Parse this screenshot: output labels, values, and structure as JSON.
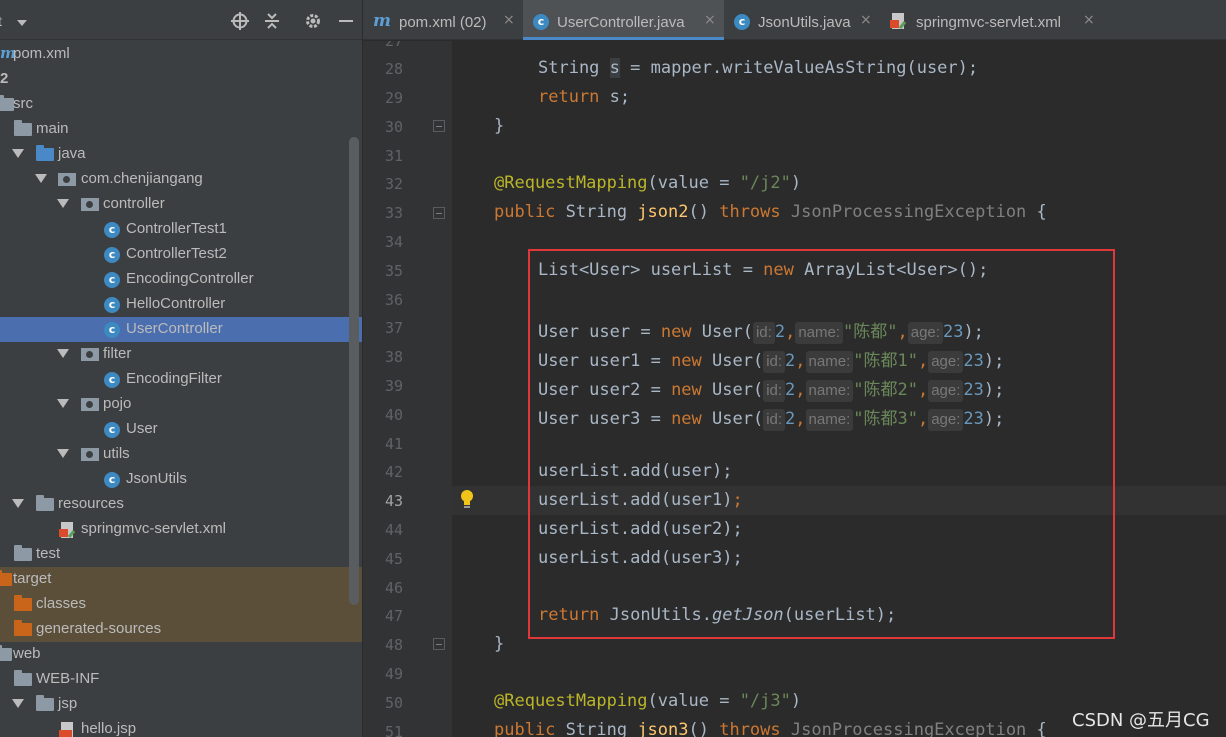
{
  "panel": {
    "title": "t",
    "tree": [
      {
        "label": "pom.xml",
        "icon": "maven-icon"
      },
      {
        "label": "2",
        "icon": "none"
      },
      {
        "label": "src",
        "icon": "folder-icon"
      },
      {
        "label": "main",
        "icon": "folder-icon"
      },
      {
        "label": "java",
        "icon": "source-folder-icon"
      },
      {
        "label": "com.chenjiangang",
        "icon": "package-icon"
      },
      {
        "label": "controller",
        "icon": "package-icon"
      },
      {
        "label": "ControllerTest1",
        "icon": "class-icon"
      },
      {
        "label": "ControllerTest2",
        "icon": "class-icon"
      },
      {
        "label": "EncodingController",
        "icon": "class-icon"
      },
      {
        "label": "HelloController",
        "icon": "class-icon"
      },
      {
        "label": "UserController",
        "icon": "class-icon"
      },
      {
        "label": "filter",
        "icon": "package-icon"
      },
      {
        "label": "EncodingFilter",
        "icon": "class-icon"
      },
      {
        "label": "pojo",
        "icon": "package-icon"
      },
      {
        "label": "User",
        "icon": "class-icon"
      },
      {
        "label": "utils",
        "icon": "package-icon"
      },
      {
        "label": "JsonUtils",
        "icon": "class-icon"
      },
      {
        "label": "resources",
        "icon": "resources-folder-icon"
      },
      {
        "label": "springmvc-servlet.xml",
        "icon": "xml-file-icon"
      },
      {
        "label": "test",
        "icon": "folder-icon"
      },
      {
        "label": "target",
        "icon": "excluded-folder-icon"
      },
      {
        "label": "classes",
        "icon": "excluded-folder-icon"
      },
      {
        "label": "generated-sources",
        "icon": "excluded-folder-icon"
      },
      {
        "label": "web",
        "icon": "folder-icon"
      },
      {
        "label": "WEB-INF",
        "icon": "folder-icon"
      },
      {
        "label": "jsp",
        "icon": "folder-icon"
      },
      {
        "label": "hello.jsp",
        "icon": "jsp-file-icon"
      }
    ],
    "selected": "UserController"
  },
  "tabs": [
    {
      "label": "pom.xml (02)",
      "icon": "maven-icon",
      "close": "×"
    },
    {
      "label": "UserController.java",
      "icon": "class-icon",
      "close": "×",
      "active": true
    },
    {
      "label": "JsonUtils.java",
      "icon": "class-icon",
      "close": "×"
    },
    {
      "label": "springmvc-servlet.xml",
      "icon": "xml-file-icon",
      "close": "×"
    }
  ],
  "editor": {
    "line_numbers": [
      "27",
      "28",
      "29",
      "30",
      "31",
      "32",
      "33",
      "34",
      "35",
      "36",
      "37",
      "38",
      "39",
      "40",
      "41",
      "42",
      "43",
      "44",
      "45",
      "46",
      "47",
      "48",
      "49",
      "50",
      "51"
    ],
    "current_line": "43",
    "code": {
      "l28_a": "String ",
      "l28_var": "s",
      "l28_b": " = mapper.writeValueAsString(user);",
      "l29_kw": "return",
      "l29_b": " s;",
      "l30": "}",
      "l32_ann": "@RequestMapping",
      "l32_a": "(",
      "l32_key": "value",
      "l32_b": " = ",
      "l32_str": "\"/j2\"",
      "l32_c": ")",
      "l33_kw": "public",
      "l33_a": " String ",
      "l33_fn": "json2",
      "l33_b": "() ",
      "l33_kw2": "throws",
      "l33_c": " ",
      "l33_exc": "JsonProcessingException",
      "l33_d": " {",
      "l35_a": "List<User> userList = ",
      "l35_kw": "new",
      "l35_b": " ArrayList<User>();",
      "l37_a": "User user = ",
      "l37_kw": "new",
      "l37_b": " User(",
      "l38_a": "User user1 = ",
      "l38_kw": "new",
      "l38_b": " User(",
      "l39_a": "User user2 = ",
      "l39_kw": "new",
      "l39_b": " User(",
      "l40_a": "User user3 = ",
      "l40_kw": "new",
      "l40_b": " User(",
      "hint_id": "id:",
      "hint_name": "name:",
      "hint_age": "age:",
      "val_id": "2",
      "comma": ",",
      "val_age": "23",
      "end": ");",
      "name0": "\"陈都\"",
      "name1": "\"陈都1\"",
      "name2": "\"陈都2\"",
      "name3": "\"陈都3\"",
      "l42": "userList.add(user);",
      "l43_a": "userList.add(user1)",
      "l43_b": ";",
      "l44": "userList.add(user2);",
      "l45": "userList.add(user3);",
      "l47_kw": "return",
      "l47_a": " JsonUtils.",
      "l47_fn": "getJson",
      "l47_b": "(userList);",
      "l48": "}",
      "l50_ann": "@RequestMapping",
      "l50_a": "(",
      "l50_key": "value",
      "l50_b": " = ",
      "l50_str": "\"/j3\"",
      "l50_c": ")",
      "l51_kw": "public",
      "l51_a": " String ",
      "l51_fn": "json3",
      "l51_b": "() ",
      "l51_kw2": "throws",
      "l51_c": " ",
      "l51_exc": "JsonProcessingException",
      "l51_d": " {"
    }
  },
  "watermark": "CSDN @五月CG",
  "colors": {
    "selection": "#4b6eaf",
    "keyword": "#cc7832",
    "string": "#6a8759",
    "number": "#6897bb",
    "annotation": "#bbb529",
    "highlight_box": "#e0383a"
  }
}
